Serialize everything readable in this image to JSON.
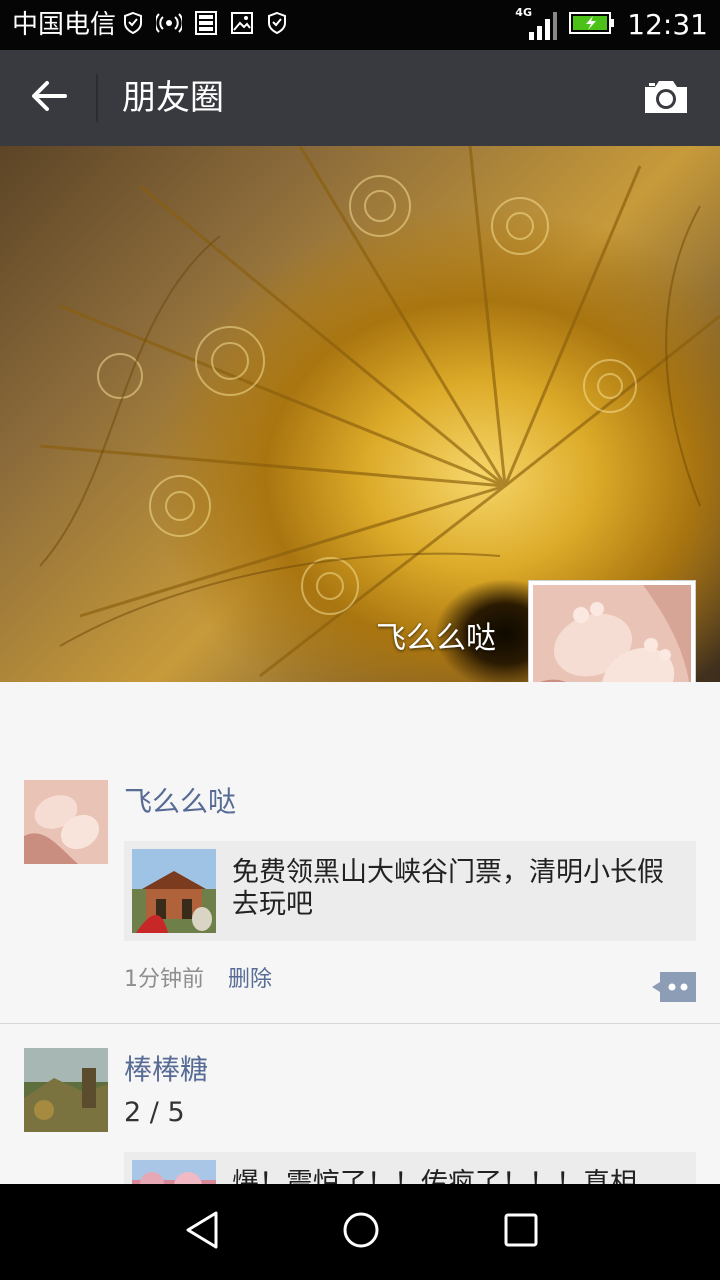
{
  "status_bar": {
    "carrier": "中国电信",
    "network": "4G",
    "time": "12:31",
    "icons": [
      "shield-icon",
      "hotspot-icon",
      "storage-icon",
      "image-icon",
      "shield-icon",
      "signal-icon",
      "battery-icon"
    ]
  },
  "header": {
    "title": "朋友圈",
    "icons": [
      "back-arrow-icon",
      "camera-icon"
    ]
  },
  "cover": {
    "user_name": "飞么么哒"
  },
  "posts": [
    {
      "author": "飞么么哒",
      "share_text": "免费领黑山大峡谷门票，清明小长假去玩吧",
      "time": "1分钟前",
      "delete_label": "删除"
    },
    {
      "author": "棒棒糖",
      "page_counter": "2 / 5",
      "share_text": "爆！震惊了！！传疯了！！！真相"
    }
  ],
  "colors": {
    "header_bg": "#393a3f",
    "link": "#576b95",
    "feed_bg": "#f6f6f6"
  }
}
